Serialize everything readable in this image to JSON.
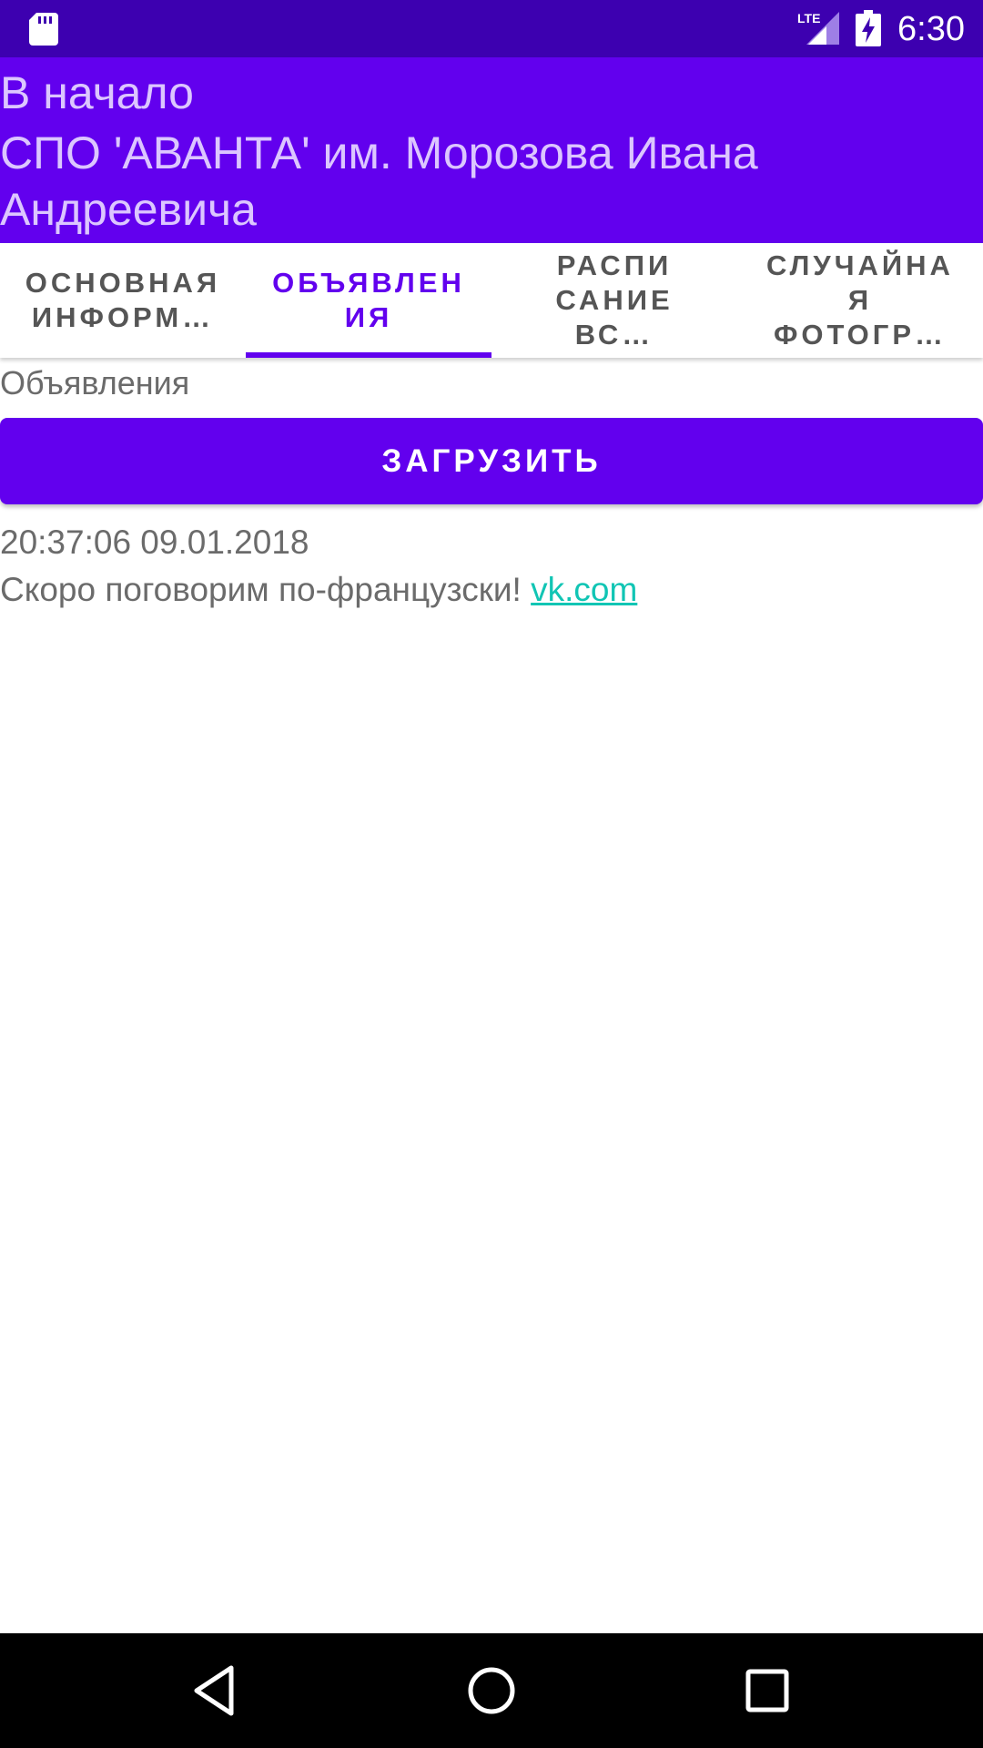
{
  "status_bar": {
    "time": "6:30",
    "network": "LTE",
    "icons": [
      "sd-card-icon",
      "signal-icon",
      "battery-charging-icon"
    ]
  },
  "header": {
    "home_link": "В начало",
    "title": "СПО 'АВАНТА' им. Морозова Ивана Андреевича"
  },
  "tabs": [
    {
      "label": "ОСНОВНАЯ ИНФОРМ…",
      "active": false
    },
    {
      "label": "ОБЪЯВЛЕН ИЯ",
      "active": true
    },
    {
      "label": "РАСПИ САНИЕ ВС…",
      "active": false
    },
    {
      "label": "СЛУЧАЙНА Я ФОТОГР…",
      "active": false
    }
  ],
  "tabs_display": [
    "ОСНОВНАЯ\nИНФОРМ…",
    "ОБЪЯВЛЕН\nИЯ",
    "РАСПИ\nСАНИЕ ВС…",
    "СЛУЧАЙНА\nЯ ФОТОГР…"
  ],
  "content": {
    "section_title": "Объявления",
    "load_button": "ЗАГРУЗИТЬ",
    "announcement": {
      "timestamp": "20:37:06 09.01.2018",
      "text": "Скоро поговорим по-французски! ",
      "link_text": "vk.com"
    }
  },
  "nav_bar": {
    "icons": [
      "back-icon",
      "home-icon",
      "recents-icon"
    ]
  },
  "colors": {
    "status_bar": "#3d00b0",
    "primary": "#6200ee",
    "header_text": "#dcc6ff",
    "link": "#11c5b4",
    "body_text": "#6b6b6b"
  }
}
